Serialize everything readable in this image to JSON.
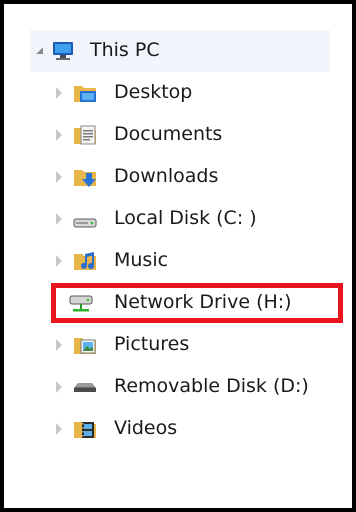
{
  "tree": {
    "root": {
      "label": "This PC",
      "icon": "computer-icon",
      "expanded": true
    },
    "items": [
      {
        "label": "Desktop",
        "icon": "desktop-folder-icon"
      },
      {
        "label": "Documents",
        "icon": "documents-folder-icon"
      },
      {
        "label": "Downloads",
        "icon": "downloads-folder-icon"
      },
      {
        "label": "Local Disk (C: )",
        "icon": "hard-drive-icon"
      },
      {
        "label": "Music",
        "icon": "music-folder-icon"
      },
      {
        "label": "Network Drive (H:)",
        "icon": "network-drive-icon",
        "highlighted": true
      },
      {
        "label": "Pictures",
        "icon": "pictures-folder-icon"
      },
      {
        "label": "Removable Disk (D:)",
        "icon": "removable-disk-icon"
      },
      {
        "label": "Videos",
        "icon": "videos-folder-icon"
      }
    ]
  },
  "colors": {
    "highlight_border": "#e8141e",
    "frame_border": "#000000",
    "root_background": "#f2f6fc",
    "folder_yellow": "#e8b64a"
  }
}
